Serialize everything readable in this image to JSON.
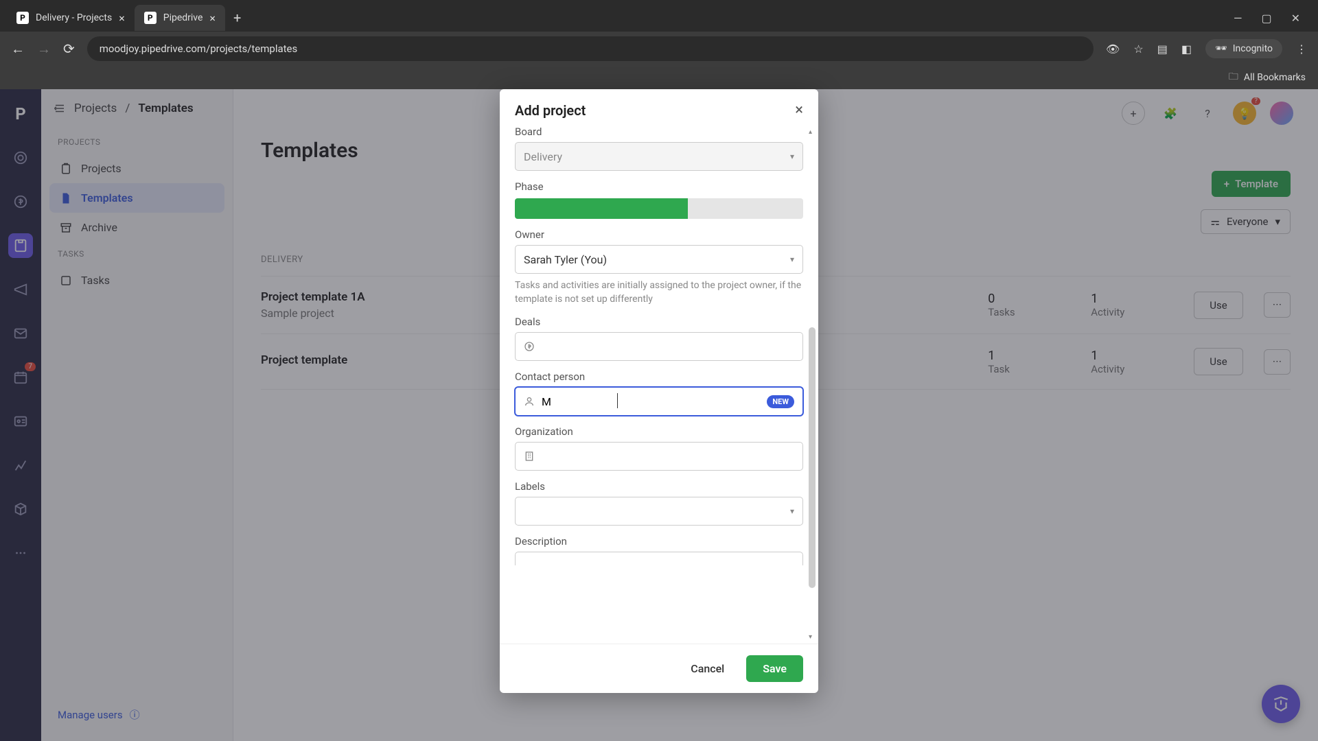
{
  "browser": {
    "tabs": [
      {
        "title": "Delivery - Projects",
        "active": false
      },
      {
        "title": "Pipedrive",
        "active": true
      }
    ],
    "url": "moodjoy.pipedrive.com/projects/templates",
    "incognito_label": "Incognito",
    "bookmarks_label": "All Bookmarks"
  },
  "breadcrumb": {
    "parent": "Projects",
    "current": "Templates"
  },
  "sidebar": {
    "sections": {
      "projects_label": "PROJECTS",
      "tasks_label": "TASKS"
    },
    "items": {
      "projects": "Projects",
      "templates": "Templates",
      "archive": "Archive",
      "tasks": "Tasks"
    },
    "manage_users": "Manage users"
  },
  "rail_badge": "7",
  "page": {
    "title": "Templates",
    "template_button": "Template",
    "filter_label": "Everyone",
    "section": "DELIVERY"
  },
  "templates": [
    {
      "name": "Project template 1A",
      "desc": "Sample project",
      "tasks_n": "0",
      "tasks_l": "Tasks",
      "act_n": "1",
      "act_l": "Activity",
      "use": "Use"
    },
    {
      "name": "Project template",
      "desc": "",
      "tasks_n": "1",
      "tasks_l": "Task",
      "act_n": "1",
      "act_l": "Activity",
      "use": "Use"
    }
  ],
  "modal": {
    "title": "Add project",
    "labels": {
      "board": "Board",
      "phase": "Phase",
      "owner": "Owner",
      "deals": "Deals",
      "contact": "Contact person",
      "org": "Organization",
      "labels_field": "Labels",
      "description": "Description"
    },
    "board_value": "Delivery",
    "owner_value": "Sarah Tyler (You)",
    "owner_help": "Tasks and activities are initially assigned to the project owner, if the template is not set up differently",
    "contact_value": "M",
    "new_badge": "NEW",
    "cancel": "Cancel",
    "save": "Save"
  },
  "top_badge": "?"
}
